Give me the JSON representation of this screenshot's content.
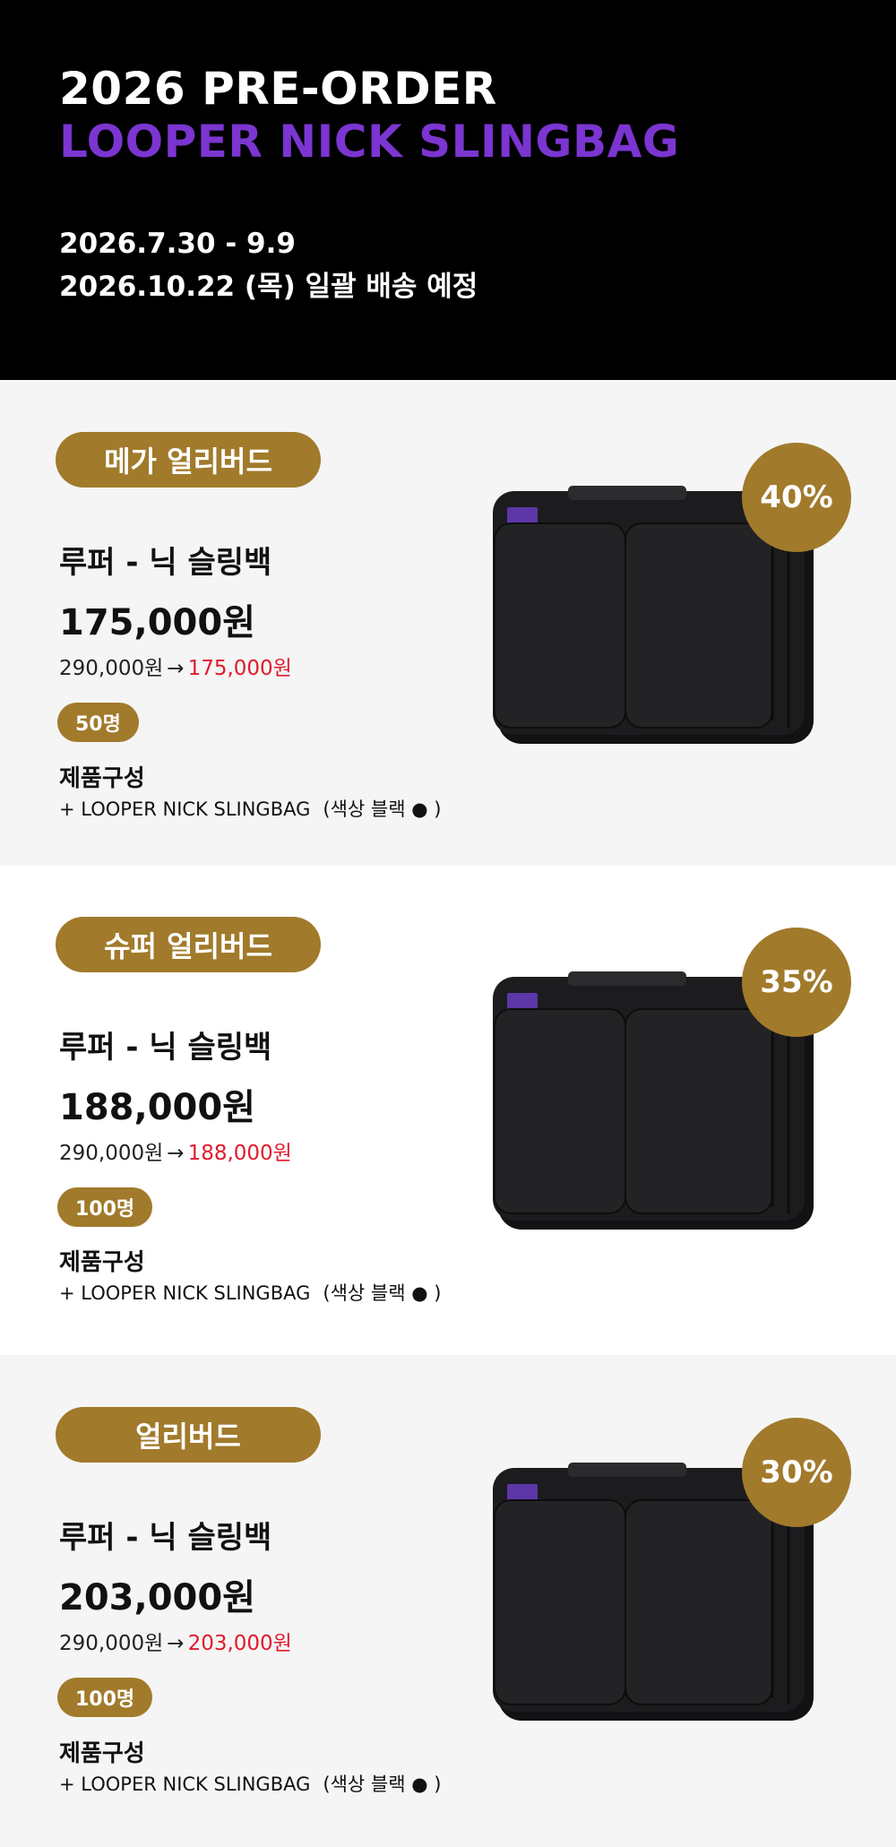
{
  "colors": {
    "accent_gold": "#A17A2B",
    "accent_purple": "#7B35D1",
    "price_red": "#E01B2A",
    "hero_bg": "#000000",
    "tier_bg_light": "#F5F5F5",
    "tier_bg_white": "#FFFFFF"
  },
  "hero": {
    "title": "2026 PRE-ORDER",
    "subtitle": "LOOPER NICK SLINGBAG",
    "period": "2026.7.30 - 9.9",
    "shipping": "2026.10.22 (목) 일괄 배송 예정"
  },
  "tiers": [
    {
      "badge": "메가 얼리버드",
      "discount": "40%",
      "product_name": "루퍼 - 닉 슬링백",
      "price": "175,000원",
      "original_price": "290,000원",
      "arrow": "→",
      "final_price": "175,000원",
      "quantity": "50명",
      "composition_title": "제품구성",
      "composition_item": "+ LOOPER NICK SLINGBAG",
      "composition_color": "(색상 블랙 ● )",
      "image_icon": "black-slingbag-image"
    },
    {
      "badge": "슈퍼 얼리버드",
      "discount": "35%",
      "product_name": "루퍼 - 닉 슬링백",
      "price": "188,000원",
      "original_price": "290,000원",
      "arrow": "→",
      "final_price": "188,000원",
      "quantity": "100명",
      "composition_title": "제품구성",
      "composition_item": "+ LOOPER NICK SLINGBAG",
      "composition_color": "(색상 블랙 ● )",
      "image_icon": "black-slingbag-image"
    },
    {
      "badge": "얼리버드",
      "discount": "30%",
      "product_name": "루퍼 - 닉 슬링백",
      "price": "203,000원",
      "original_price": "290,000원",
      "arrow": "→",
      "final_price": "203,000원",
      "quantity": "100명",
      "composition_title": "제품구성",
      "composition_item": "+ LOOPER NICK SLINGBAG",
      "composition_color": "(색상 블랙 ● )",
      "image_icon": "black-slingbag-image"
    }
  ]
}
